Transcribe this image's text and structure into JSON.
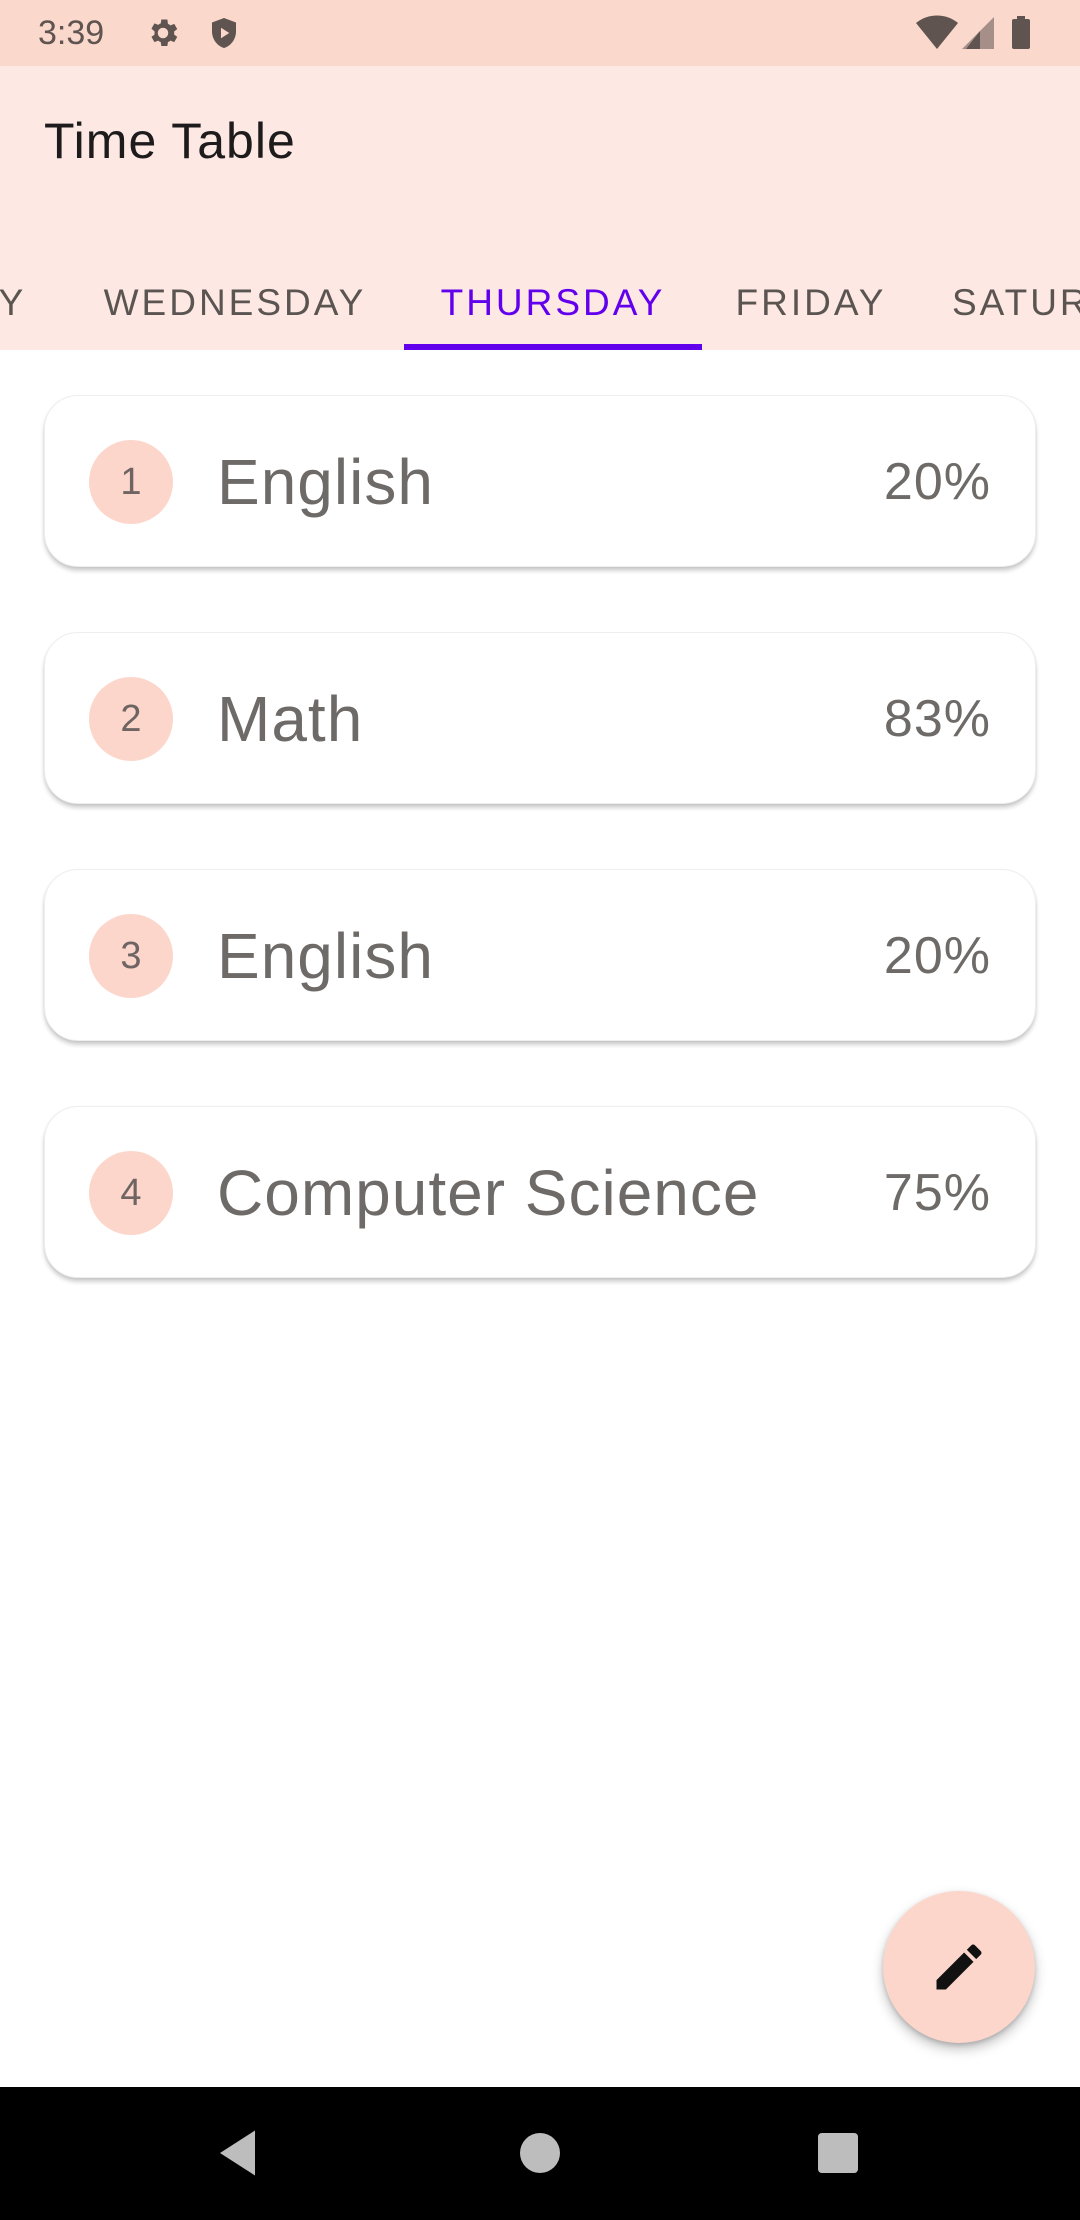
{
  "status_bar": {
    "time": "3:39",
    "icons_left": [
      "settings-icon",
      "shield-icon"
    ],
    "icons_right": [
      "wifi-icon",
      "signal-icon",
      "battery-icon"
    ]
  },
  "app_bar": {
    "title": "Time Table"
  },
  "tabs": [
    {
      "label": "AY",
      "active": false
    },
    {
      "label": "WEDNESDAY",
      "active": false
    },
    {
      "label": "THURSDAY",
      "active": true
    },
    {
      "label": "FRIDAY",
      "active": false
    },
    {
      "label": "SATUR",
      "active": false
    }
  ],
  "periods": [
    {
      "number": "1",
      "subject": "English",
      "percent": "20%"
    },
    {
      "number": "2",
      "subject": "Math",
      "percent": "83%"
    },
    {
      "number": "3",
      "subject": "English",
      "percent": "20%"
    },
    {
      "number": "4",
      "subject": "Computer Science",
      "percent": "75%"
    }
  ],
  "fab": {
    "icon": "edit-pencil-icon"
  },
  "nav_bar": {
    "buttons": [
      "back-icon",
      "home-icon",
      "recents-icon"
    ]
  },
  "colors": {
    "accent": "#6200ee",
    "status_bar_bg": "#fbd8cc",
    "app_bar_bg": "#fde8e4",
    "chip_bg": "#fcd6cb"
  }
}
